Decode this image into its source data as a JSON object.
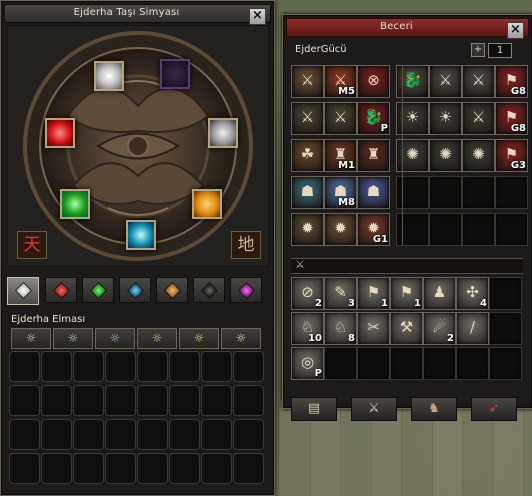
{
  "left_window": {
    "title": "Ejderha Taşı Simyası",
    "close_label": "×",
    "corner_left": "天",
    "corner_right": "地",
    "section_label": "Ejderha Elması",
    "gem_tabs": [
      "diamond",
      "ruby",
      "jade",
      "sapphire",
      "garnet",
      "onyx",
      "amethyst"
    ],
    "filter_count": 6
  },
  "right_window": {
    "title": "Beceri",
    "close_label": "×",
    "group_label": "EjderGücü",
    "points_plus": "+",
    "points_value": "1",
    "skill_labels": {
      "r0c1": "M5",
      "r0c6": "G8",
      "r1c2": "P",
      "r1c6": "G8",
      "r2c1": "M1",
      "r2c6": "G3",
      "r3c1": "M8",
      "r4c2": "G1"
    },
    "bottom_labels": {
      "r0c0": "2",
      "r0c1": "3",
      "r0c2": "1",
      "r0c3": "1",
      "r0c5": "4",
      "r1c0": "10",
      "r1c1": "8",
      "r1c4": "2",
      "r2c0": "P"
    }
  }
}
